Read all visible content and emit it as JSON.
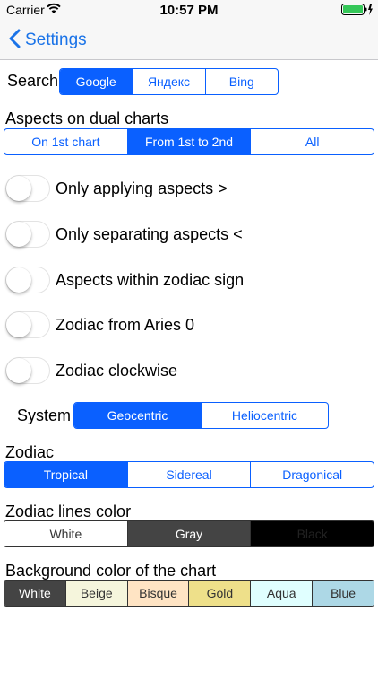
{
  "status": {
    "carrier": "Carrier",
    "time": "10:57 PM"
  },
  "nav": {
    "back_label": "Settings"
  },
  "search": {
    "label": "Search",
    "options": [
      "Google",
      "Яндекс",
      "Bing"
    ],
    "selected": 0
  },
  "aspects": {
    "label": "Aspects on dual charts",
    "options": [
      "On 1st chart",
      "From 1st to 2nd",
      "All"
    ],
    "selected": 1
  },
  "toggles": [
    {
      "label": "Only applying aspects >",
      "on": false
    },
    {
      "label": "Only separating aspects <",
      "on": false
    },
    {
      "label": "Aspects within zodiac sign",
      "on": false
    },
    {
      "label": "Zodiac from Aries 0",
      "on": false
    },
    {
      "label": "Zodiac clockwise",
      "on": false
    }
  ],
  "system": {
    "label": "System",
    "options": [
      "Geocentric",
      "Heliocentric"
    ],
    "selected": 0
  },
  "zodiac": {
    "label": "Zodiac",
    "options": [
      "Tropical",
      "Sidereal",
      "Dragonical"
    ],
    "selected": 0
  },
  "zodiac_lines": {
    "label": "Zodiac lines color",
    "options": [
      {
        "name": "White",
        "bg": "#ffffff",
        "fg": "#333333"
      },
      {
        "name": "Gray",
        "bg": "#444444",
        "fg": "#ffffff"
      },
      {
        "name": "Black",
        "bg": "#000000",
        "fg": "#222222"
      }
    ]
  },
  "background": {
    "label": "Background color of the chart",
    "options": [
      {
        "name": "White",
        "bg": "#444444",
        "fg": "#ffffff"
      },
      {
        "name": "Beige",
        "bg": "#f5f5dc",
        "fg": "#333333"
      },
      {
        "name": "Bisque",
        "bg": "#ffe4c4",
        "fg": "#333333"
      },
      {
        "name": "Gold",
        "bg": "#eee08a",
        "fg": "#333333"
      },
      {
        "name": "Aqua",
        "bg": "#e0ffff",
        "fg": "#333333"
      },
      {
        "name": "Blue",
        "bg": "#add8e6",
        "fg": "#333333"
      }
    ]
  },
  "colors": {
    "accent": "#0a60ff"
  }
}
